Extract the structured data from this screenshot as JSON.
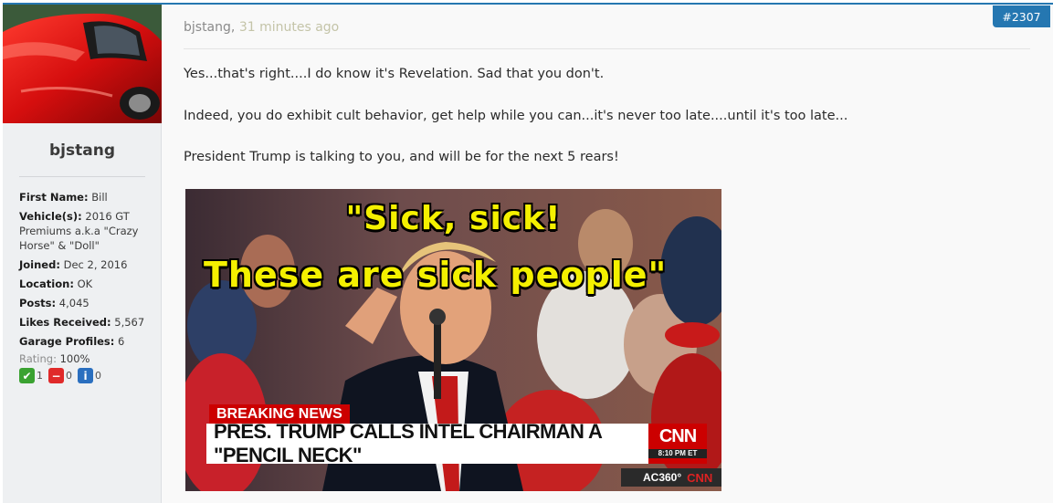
{
  "post": {
    "author": "bjstang",
    "time": "31 minutes ago",
    "number": "#2307",
    "lines": [
      "Yes...that's right....I do know it's Revelation. Sad that you don't.",
      "Indeed, you do exhibit cult behavior, get help while you can...it's never too late....until it's too late...",
      "President Trump is talking to you, and will be for the next 5 rears!"
    ]
  },
  "user": {
    "name": "bjstang",
    "info": {
      "first_name_label": "First Name:",
      "first_name": "Bill",
      "vehicle_label": "Vehicle(s):",
      "vehicle": "2016 GT Premiums a.k.a \"Crazy Horse\" & \"Doll\"",
      "joined_label": "Joined:",
      "joined": "Dec 2, 2016",
      "location_label": "Location:",
      "location": "OK",
      "posts_label": "Posts:",
      "posts": "4,045",
      "likes_label": "Likes Received:",
      "likes": "5,567",
      "garage_label": "Garage Profiles:",
      "garage": "6",
      "rating_label": "Rating:",
      "rating": "100%"
    },
    "feedback": {
      "positive": "1",
      "negative": "0",
      "neutral": "0"
    }
  },
  "image": {
    "caption_line1": "\"Sick, sick!",
    "caption_line2": "These are sick people\"",
    "breaking": "BREAKING NEWS",
    "headline": "PRES. TRUMP CALLS INTEL CHAIRMAN A \"PENCIL NECK\"",
    "network": "CNN",
    "time": "8:10 PM ET",
    "show": "AC360°",
    "show_network": "CNN"
  },
  "colors": {
    "accent": "#2577b1",
    "positive": "#3aa231",
    "negative": "#e02a2a",
    "neutral": "#2a6fbf"
  }
}
